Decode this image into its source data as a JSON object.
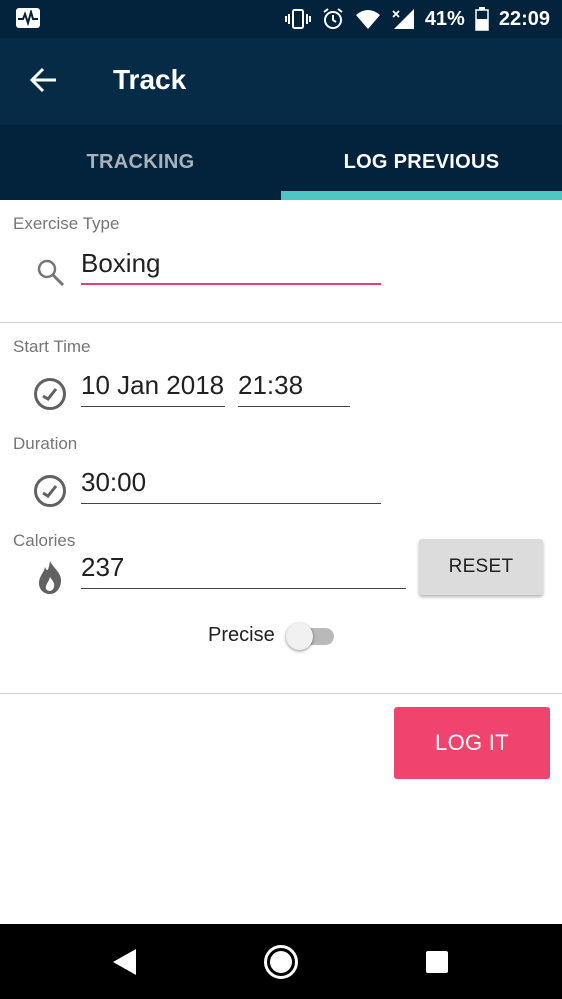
{
  "status_bar": {
    "battery_percent": "41%",
    "time": "22:09",
    "icons": [
      "activity-icon",
      "vibrate-icon",
      "alarm-icon",
      "wifi-icon",
      "signal-icon",
      "battery-icon"
    ]
  },
  "app_bar": {
    "title": "Track",
    "back_icon": "arrow-back-icon"
  },
  "tabs": [
    {
      "label": "TRACKING",
      "active": false
    },
    {
      "label": "LOG PREVIOUS",
      "active": true
    }
  ],
  "form": {
    "exercise_type": {
      "label": "Exercise Type",
      "value": "Boxing",
      "icon": "search-icon"
    },
    "start_time": {
      "label": "Start Time",
      "date": "10 Jan 2018",
      "time": "21:38",
      "icon": "clock-icon"
    },
    "duration": {
      "label": "Duration",
      "value": "30:00",
      "icon": "clock-icon"
    },
    "calories": {
      "label": "Calories",
      "value": "237",
      "icon": "flame-icon",
      "reset_label": "RESET"
    },
    "precise": {
      "label": "Precise",
      "enabled": false
    }
  },
  "log_button": {
    "label": "LOG IT"
  },
  "colors": {
    "status_bar": "#03223b",
    "app_bar": "#062b46",
    "tab_indicator": "#4ec7c4",
    "accent": "#f0446f",
    "focused_underline": "#e8416f"
  },
  "nav_bar": {
    "icons": [
      "back-triangle-icon",
      "home-circle-icon",
      "recents-square-icon"
    ]
  }
}
